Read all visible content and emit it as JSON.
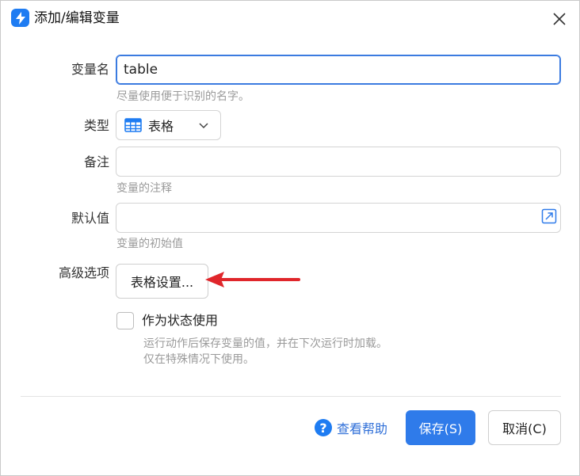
{
  "dialog": {
    "title": "添加/编辑变量",
    "close_icon": "close-icon",
    "app_icon": "lightning-icon"
  },
  "form": {
    "name_label": "变量名",
    "name_value": "table",
    "name_hint": "尽量使用便于识别的名字。",
    "type_label": "类型",
    "type_value": "表格",
    "type_icon": "table-grid-icon",
    "note_label": "备注",
    "note_value": "",
    "note_hint": "变量的注释",
    "default_label": "默认值",
    "default_value": "",
    "default_hint": "变量的初始值",
    "advanced_label": "高级选项",
    "table_settings_button": "表格设置...",
    "state_checkbox_label": "作为状态使用",
    "state_checkbox_checked": false,
    "state_hint_line1": "运行动作后保存变量的值，并在下次运行时加载。",
    "state_hint_line2": "仅在特殊情况下使用。"
  },
  "footer": {
    "help_label": "查看帮助",
    "save_label": "保存(S)",
    "cancel_label": "取消(C)"
  },
  "colors": {
    "accent": "#2f7bea",
    "annotation_arrow": "#e0262b",
    "hint_text": "#9a9a9a"
  }
}
